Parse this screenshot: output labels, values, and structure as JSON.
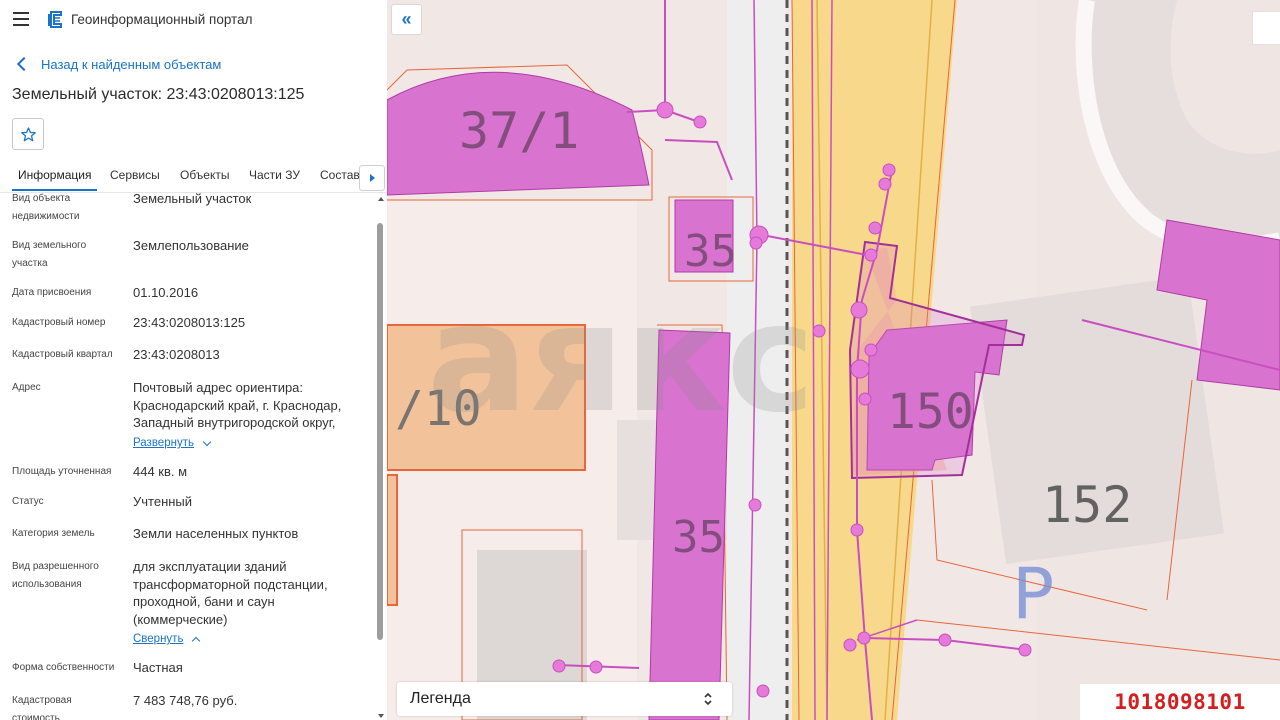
{
  "header": {
    "app_title": "Геоинформационный портал",
    "menu_icon": "hamburger-icon",
    "logo_icon": "portal-logo-icon"
  },
  "back_link": "Назад к найденным объектам",
  "object_title": "Земельный участок: 23:43:0208013:125",
  "favorite_icon": "star-icon",
  "tabs": [
    {
      "label": "Информация",
      "active": true
    },
    {
      "label": "Сервисы"
    },
    {
      "label": "Объекты"
    },
    {
      "label": "Части ЗУ"
    },
    {
      "label": "Состав"
    }
  ],
  "properties": [
    {
      "label": "Вид объекта недвижимости",
      "value": "Земельный участок"
    },
    {
      "label": "Вид земельного участка",
      "value": "Землепользование"
    },
    {
      "label": "Дата присвоения",
      "value": "01.10.2016"
    },
    {
      "label": "Кадастровый номер",
      "value": "23:43:0208013:125"
    },
    {
      "label": "Кадастровый квартал",
      "value": "23:43:0208013"
    },
    {
      "label": "Адрес",
      "value": "Почтовый адрес ориентира: Краснодарский край, г. Краснодар, Западный внутригородской округ,",
      "link": "Развернуть"
    },
    {
      "label": "Площадь уточненная",
      "value": "444 кв. м"
    },
    {
      "label": "Статус",
      "value": "Учтенный"
    },
    {
      "label": "Категория земель",
      "value": "Земли населенных пунктов"
    },
    {
      "label": "Вид разрешенного использования",
      "value": "для эксплуатации зданий трансформаторной подстанции, проходной, бани и саун (коммерческие)",
      "link": "Свернуть"
    },
    {
      "label": "Форма собственности",
      "value": "Частная"
    },
    {
      "label": "Кадастровая стоимость",
      "value": "7 483 748,76 руб."
    }
  ],
  "map": {
    "parcel_labels": [
      "37/1",
      "35",
      "/10",
      "35",
      "150",
      "152"
    ],
    "map_watermark": "аякс",
    "parking_symbol": "P",
    "colors": {
      "parcel_fill": "#d873cf",
      "parcel_stroke": "#b13aa5",
      "road": "#f8d88a",
      "boundary": "#e8663a"
    }
  },
  "legend": {
    "label": "Легенда"
  },
  "listing_id": "1018098101"
}
